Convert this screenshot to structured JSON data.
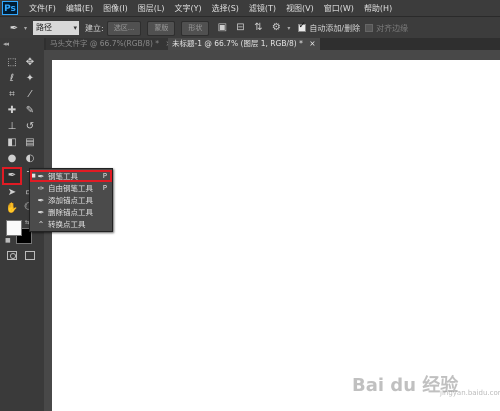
{
  "app": {
    "logo": "Ps"
  },
  "menu": [
    "文件(F)",
    "编辑(E)",
    "图像(I)",
    "图层(L)",
    "文字(Y)",
    "选择(S)",
    "滤镜(T)",
    "视图(V)",
    "窗口(W)",
    "帮助(H)"
  ],
  "options": {
    "tool_icon": "pen-icon",
    "mode_value": "路径",
    "make_label": "建立:",
    "selection_btn": "选区...",
    "mask_btn": "蒙版",
    "shape_btn": "形状",
    "auto_add_delete_label": "自动添加/删除",
    "auto_add_delete_checked": true,
    "align_edges_label": "对齐边缘",
    "align_edges_checked": false
  },
  "tabs": [
    {
      "label": "马头文件字 @ 66.7%(RGB/8) *",
      "active": false
    },
    {
      "label": "未标题-1 @ 66.7% (图层 1, RGB/8) *",
      "active": true
    }
  ],
  "flyout": {
    "items": [
      {
        "icon": "pen-icon",
        "label": "钢笔工具",
        "shortcut": "P",
        "selected": true
      },
      {
        "icon": "freeform-pen-icon",
        "label": "自由钢笔工具",
        "shortcut": "P",
        "selected": false
      },
      {
        "icon": "add-anchor-point-icon",
        "label": "添加锚点工具",
        "shortcut": "",
        "selected": false
      },
      {
        "icon": "delete-anchor-point-icon",
        "label": "删除锚点工具",
        "shortcut": "",
        "selected": false
      },
      {
        "icon": "convert-point-icon",
        "label": "转换点工具",
        "shortcut": "",
        "selected": false
      }
    ]
  },
  "colors": {
    "foreground": "#fafafa",
    "background": "#000000",
    "highlight": "#e01b24"
  },
  "watermark": {
    "main": "Bai du 经验",
    "sub": "jingyan.baidu.com"
  }
}
